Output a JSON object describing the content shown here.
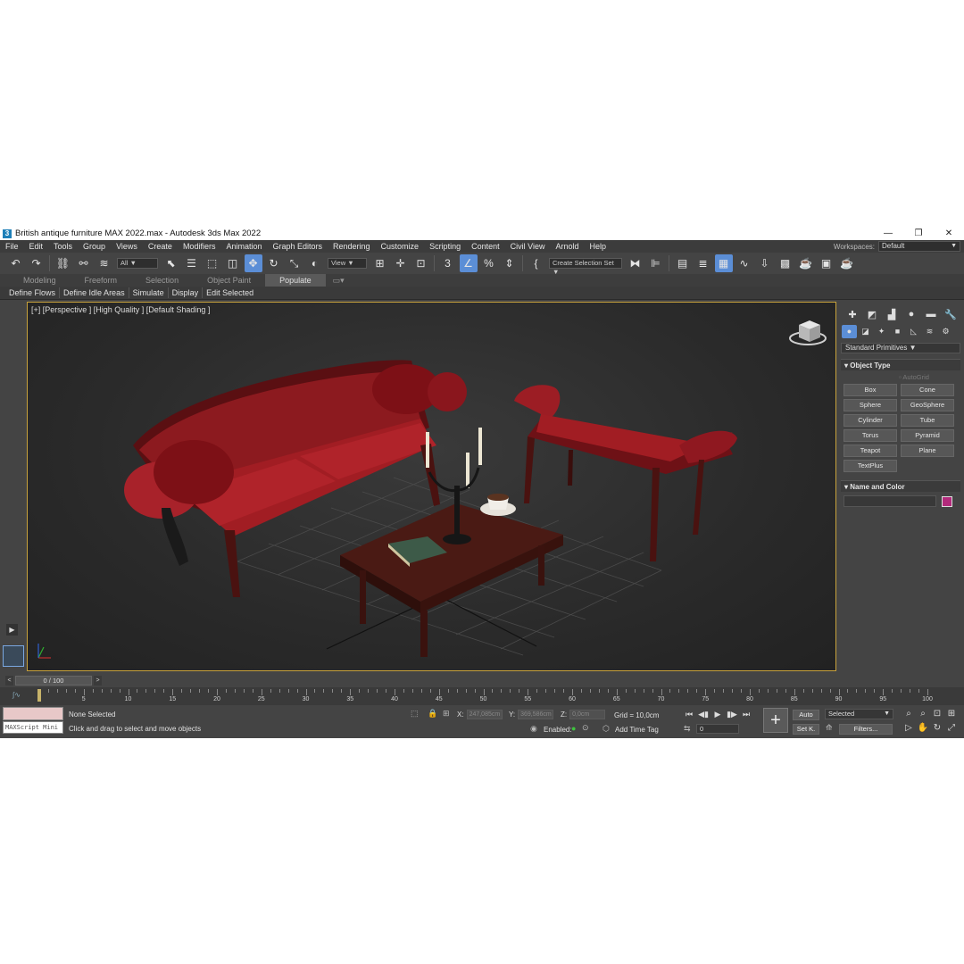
{
  "window": {
    "app_icon": "3",
    "title": "British antique furniture MAX 2022.max - Autodesk 3ds Max 2022",
    "minimize": "—",
    "maximize": "❐",
    "close": "✕"
  },
  "menu": [
    "File",
    "Edit",
    "Tools",
    "Group",
    "Views",
    "Create",
    "Modifiers",
    "Animation",
    "Graph Editors",
    "Rendering",
    "Customize",
    "Scripting",
    "Content",
    "Civil View",
    "Arnold",
    "Help"
  ],
  "workspaces": {
    "label": "Workspaces:",
    "value": "Default"
  },
  "toolbar": {
    "filter": "All",
    "ref_coord": "View",
    "selection_set": "Create Selection Set"
  },
  "ribbon": {
    "tabs": [
      "Modeling",
      "Freeform",
      "Selection",
      "Object Paint",
      "Populate"
    ],
    "tools": [
      "Define Flows",
      "Define Idle Areas",
      "Simulate",
      "Display",
      "Edit Selected"
    ]
  },
  "viewport": {
    "label": "[+] [Perspective ] [High Quality ] [Default Shading ]"
  },
  "command_panel": {
    "category": "Standard Primitives",
    "object_type_title": "Object Type",
    "autogrid": "AutoGrid",
    "primitives": [
      "Box",
      "Cone",
      "Sphere",
      "GeoSphere",
      "Cylinder",
      "Tube",
      "Torus",
      "Pyramid",
      "Teapot",
      "Plane",
      "TextPlus"
    ],
    "name_color_title": "Name and Color",
    "object_color": "#b32a7c"
  },
  "time": {
    "slider": "0 / 100",
    "ruler_labels": [
      "5",
      "10",
      "15",
      "20",
      "25",
      "30",
      "35",
      "40",
      "45",
      "50",
      "55",
      "60",
      "65",
      "70",
      "75",
      "80",
      "85",
      "90",
      "95",
      "100"
    ]
  },
  "status": {
    "maxscript": "MAXScript Mini",
    "selection": "None Selected",
    "prompt": "Click and drag to select and move objects",
    "x_label": "X:",
    "x_value": "247,085cm",
    "y_label": "Y:",
    "y_value": "369,586cm",
    "z_label": "Z:",
    "z_value": "0,0cm",
    "grid": "Grid = 10,0cm",
    "enabled": "Enabled:",
    "add_time_tag": "Add Time Tag",
    "frame": "0",
    "auto": "Auto",
    "set_key": "Set K.",
    "key_filter": "Selected",
    "filters": "Filters..."
  }
}
